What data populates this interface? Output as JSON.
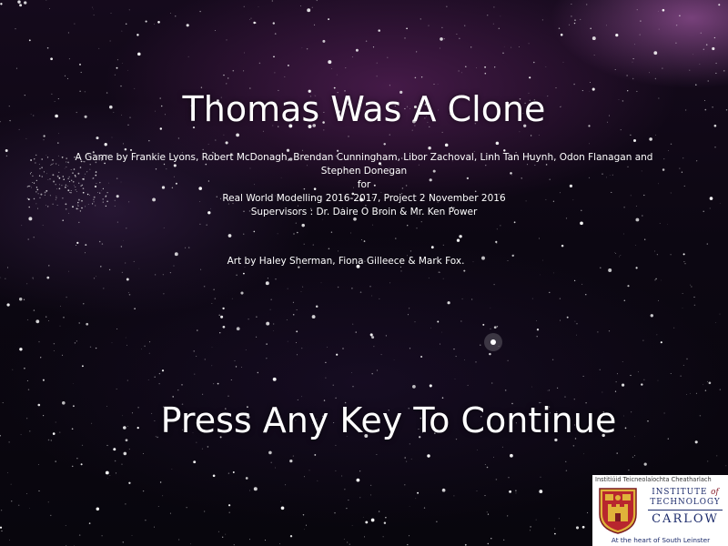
{
  "game": {
    "title": "Thomas Was A Clone",
    "credits": {
      "line1": "A Game by Frankie Lyons, Robert McDonagh, Brendan Cunningham, Libor Zachoval, Linh Tan Huynh, Odon Flanagan and Stephen Donegan",
      "line2": "for",
      "line3": "Real World Modelling 2016-2017, Project 2 November 2016",
      "line4": "Supervisors : Dr. Daire O Broin & Mr. Ken Power"
    },
    "art_credit": "Art by Haley Sherman, Fiona Gilleece & Mark Fox.",
    "prompt": "Press Any Key To Continue"
  },
  "logo": {
    "irish_name": "Institiúid Teicneolaíochta Cheatharlach",
    "institute": "INSTITUTE",
    "of": "of",
    "technology": "TECHNOLOGY",
    "carlow": "CARLOW",
    "tagline": "At the heart of South Leinster",
    "colors": {
      "navy": "#1b2a6b",
      "crest_red": "#b8262e",
      "crest_gold": "#e0b23a"
    }
  },
  "colors": {
    "text": "#ffffff",
    "space_top": "#150a1c",
    "space_bottom": "#08060d",
    "nebula": "#6e286e"
  }
}
